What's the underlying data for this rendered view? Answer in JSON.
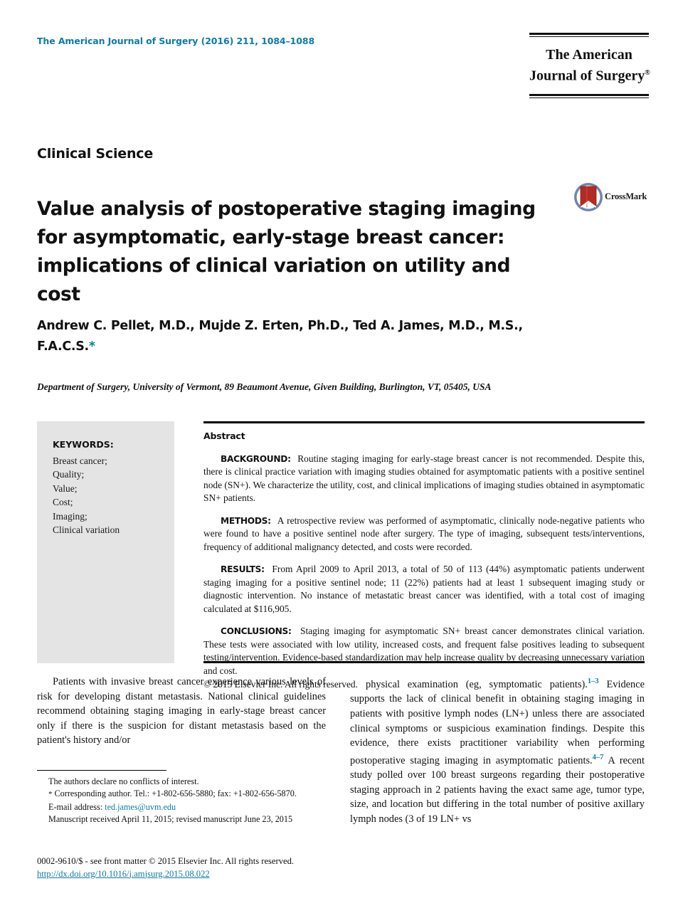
{
  "masthead": {
    "running_head": "The American Journal of Surgery (2016) 211, 1084–1088",
    "logo_line1": "The American",
    "logo_line2": "Journal of Surgery",
    "logo_registered": "®"
  },
  "section_label": "Clinical Science",
  "article": {
    "title": "Value analysis of postoperative staging imaging for asymptomatic, early-stage breast cancer: implications of clinical variation on utility and cost",
    "authors": "Andrew C. Pellet, M.D., Mujde Z. Erten, Ph.D., Ted A. James, M.D., M.S., F.A.C.S.",
    "corresponding_marker": "*",
    "affiliation": "Department of Surgery, University of Vermont, 89 Beaumont Avenue, Given Building, Burlington, VT, 05405, USA"
  },
  "crossmark": {
    "label": "CrossMark",
    "circle_color": "#4a6fa5",
    "ribbon_color": "#c0392b"
  },
  "keywords": {
    "title": "KEYWORDS:",
    "items": [
      "Breast cancer;",
      "Quality;",
      "Value;",
      "Cost;",
      "Imaging;",
      "Clinical variation"
    ]
  },
  "abstract": {
    "heading": "Abstract",
    "background_label": "BACKGROUND:",
    "background_text": "Routine staging imaging for early-stage breast cancer is not recommended. Despite this, there is clinical practice variation with imaging studies obtained for asymptomatic patients with a positive sentinel node (SN+). We characterize the utility, cost, and clinical implications of imaging studies obtained in asymptomatic SN+ patients.",
    "methods_label": "METHODS:",
    "methods_text": "A retrospective review was performed of asymptomatic, clinically node-negative patients who were found to have a positive sentinel node after surgery. The type of imaging, subsequent tests/interventions, frequency of additional malignancy detected, and costs were recorded.",
    "results_label": "RESULTS:",
    "results_text": "From April 2009 to April 2013, a total of 50 of 113 (44%) asymptomatic patients underwent staging imaging for a positive sentinel node; 11 (22%) patients had at least 1 subsequent imaging study or diagnostic intervention. No instance of metastatic breast cancer was identified, with a total cost of imaging calculated at $116,905.",
    "conclusions_label": "CONCLUSIONS:",
    "conclusions_text": "Staging imaging for asymptomatic SN+ breast cancer demonstrates clinical variation. These tests were associated with low utility, increased costs, and frequent false positives leading to subsequent testing/intervention. Evidence-based standardization may help increase quality by decreasing unnecessary variation and cost.",
    "copyright": "© 2015 Elsevier Inc. All rights reserved."
  },
  "body": {
    "left_column": "Patients with invasive breast cancer experience various levels of risk for developing distant metastasis. National clinical guidelines recommend obtaining staging imaging in early-stage breast cancer only if there is the suspicion for distant metastasis based on the patient's history and/or",
    "right_column_part1": "physical examination (eg, symptomatic patients).",
    "right_citation_1": "1–3",
    "right_column_part2": " Evidence supports the lack of clinical benefit in obtaining staging imaging in patients with positive lymph nodes (LN+) unless there are associated clinical symptoms or suspicious examination findings. Despite this evidence, there exists practitioner variability when performing postoperative staging imaging in asymptomatic patients.",
    "right_citation_2": "4–7",
    "right_column_part3": " A recent study polled over 100 breast surgeons regarding their postoperative staging approach in 2 patients having the exact same age, tumor type, size, and location but differing in the total number of positive axillary lymph nodes (3 of 19 LN+ vs"
  },
  "footnotes": {
    "conflict": "The authors declare no conflicts of interest.",
    "corresponding_marker": "*",
    "corresponding": "Corresponding author. Tel.: +1-802-656-5880; fax: +1-802-656-5870.",
    "email_label": "E-mail address:",
    "email": "ted.james@uvm.edu",
    "manuscript_dates": "Manuscript received April 11, 2015; revised manuscript June 23, 2015"
  },
  "footer": {
    "issn_line": "0002-9610/$ - see front matter © 2015 Elsevier Inc. All rights reserved.",
    "doi": "http://dx.doi.org/10.1016/j.amjsurg.2015.08.022"
  }
}
